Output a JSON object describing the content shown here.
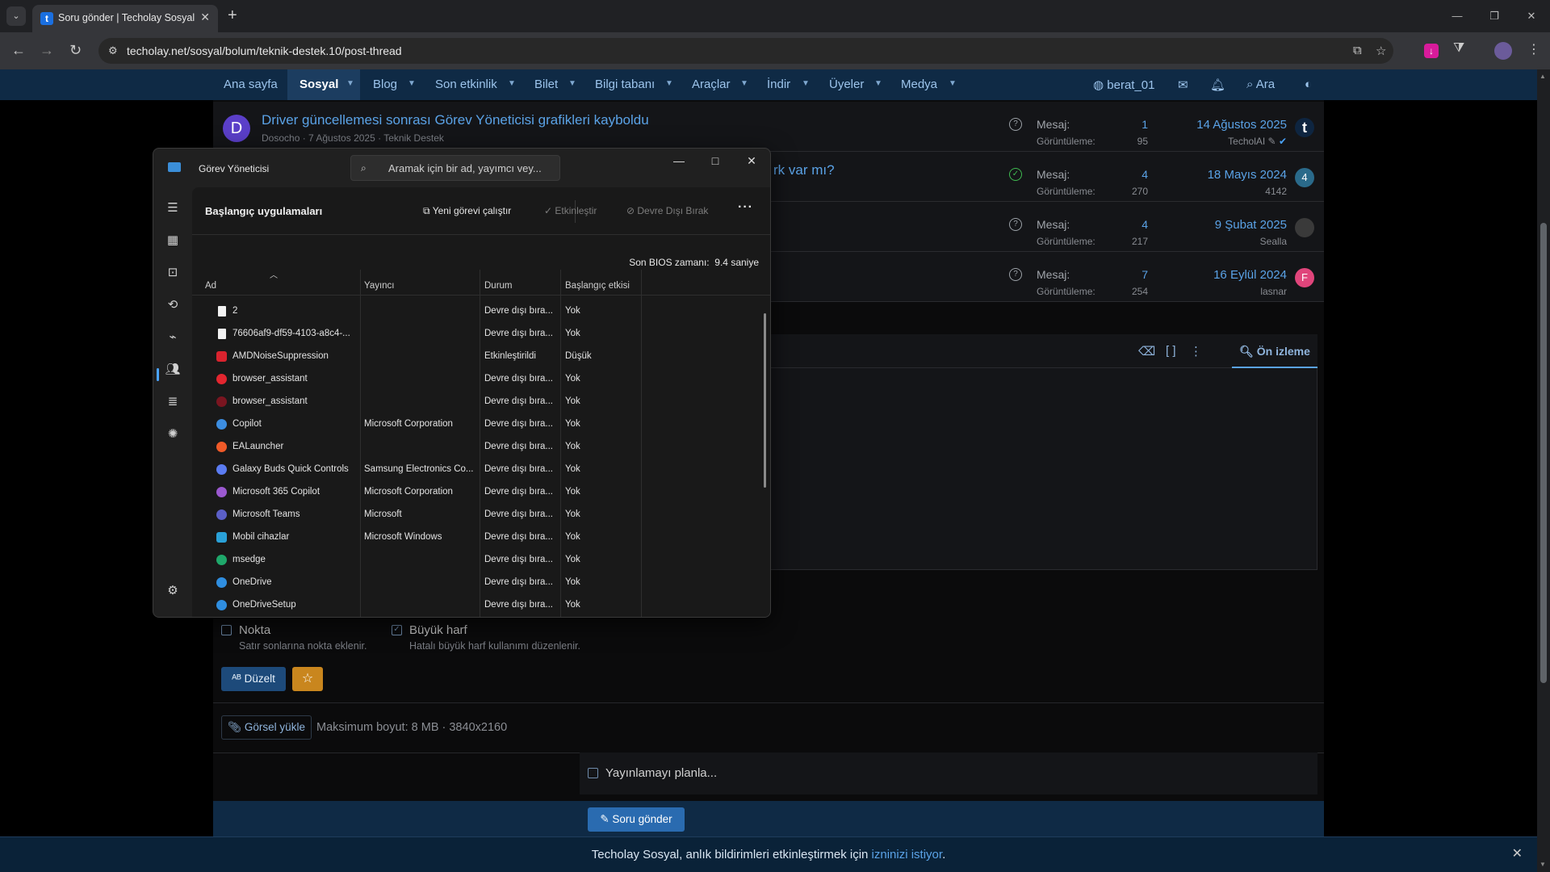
{
  "browser": {
    "tab_title": "Soru gönder | Techolay Sosyal",
    "tab_favicon_letter": "t",
    "url": "techolay.net/sosyal/bolum/teknik-destek.10/post-thread"
  },
  "site_nav": {
    "items": [
      {
        "label": "Ana sayfa"
      },
      {
        "label": "Sosyal"
      },
      {
        "label": "Blog"
      },
      {
        "label": "Son etkinlik"
      },
      {
        "label": "Bilet"
      },
      {
        "label": "Bilgi tabanı"
      },
      {
        "label": "Araçlar"
      },
      {
        "label": "İndir"
      },
      {
        "label": "Üyeler"
      },
      {
        "label": "Medya"
      }
    ],
    "username": "berat_01",
    "search_label": "Ara"
  },
  "threads": [
    {
      "avatar": "D",
      "title": "Driver güncellemesi sonrası Görev Yöneticisi grafikleri kayboldu",
      "sub": "Dosocho · 7 Ağustos 2025 · Teknik Destek",
      "msg_label": "Mesaj:",
      "view_label": "Görüntüleme:",
      "messages": "1",
      "views": "95",
      "date": "14 Ağustos 2025",
      "user": "TecholAI",
      "avatar_r": "t",
      "avatar_color": "#0e2540"
    },
    {
      "avatar": "",
      "title": "rk var mı?",
      "sub": "",
      "msg_label": "Mesaj:",
      "view_label": "Görüntüleme:",
      "messages": "4",
      "views": "270",
      "date": "18 Mayıs 2024",
      "user": "4142",
      "avatar_r": "4",
      "avatar_color": "#2a6a8a"
    },
    {
      "avatar": "",
      "title": "",
      "sub": "",
      "msg_label": "Mesaj:",
      "view_label": "Görüntüleme:",
      "messages": "4",
      "views": "217",
      "date": "9 Şubat 2025",
      "user": "Sealla",
      "avatar_r": "",
      "avatar_color": "#3a3a3a"
    },
    {
      "avatar": "",
      "title": "",
      "sub": "",
      "msg_label": "Mesaj:",
      "view_label": "Görüntüleme:",
      "messages": "7",
      "views": "254",
      "date": "16 Eylül 2024",
      "user": "lasnar",
      "avatar_r": "F",
      "avatar_color": "#e0457b"
    }
  ],
  "editor": {
    "preview_label": "Ön izleme"
  },
  "options": {
    "nokta_label": "Nokta",
    "nokta_desc": "Satır sonlarına nokta eklenir.",
    "buyuk_label": "Büyük harf",
    "buyuk_desc": "Hatalı büyük harf kullanımı düzenlenir.",
    "duzelt_label": "Düzelt"
  },
  "upload": {
    "button_label": "Görsel yükle",
    "info": "Maksimum boyut: 8 MB · 3840x2160"
  },
  "schedule_label": "Yayınlamayı planla...",
  "submit_label": "Soru gönder",
  "notification": {
    "text": "Techolay Sosyal, anlık bildirimleri etkinleştirmek için ",
    "link": "izninizi istiyor",
    "end": "."
  },
  "task_manager": {
    "title": "Görev Yöneticisi",
    "search_placeholder": "Aramak için bir ad, yayımcı vey...",
    "section_title": "Başlangıç uygulamaları",
    "run_new_task": "Yeni görevi çalıştır",
    "enable": "Etkinleştir",
    "disable": "Devre Dışı Bırak",
    "bios_label": "Son BIOS zamanı:",
    "bios_value": "9.4 saniye",
    "columns": [
      "Ad",
      "Yayıncı",
      "Durum",
      "Başlangıç etkisi"
    ],
    "rows": [
      {
        "name": "2",
        "publisher": "",
        "status": "Devre dışı bıra...",
        "impact": "Yok",
        "icon": "file-icon",
        "color": "#f2f2f2"
      },
      {
        "name": "76606af9-df59-4103-a8c4-...",
        "publisher": "",
        "status": "Devre dışı bıra...",
        "impact": "Yok",
        "icon": "file-icon",
        "color": "#f2f2f2"
      },
      {
        "name": "AMDNoiseSuppression",
        "publisher": "",
        "status": "Etkinleştirildi",
        "impact": "Düşük",
        "icon": "amd-icon",
        "color": "#d9232e"
      },
      {
        "name": "browser_assistant",
        "publisher": "",
        "status": "Devre dışı bıra...",
        "impact": "Yok",
        "icon": "opera-icon",
        "color": "#e3262f"
      },
      {
        "name": "browser_assistant",
        "publisher": "",
        "status": "Devre dışı bıra...",
        "impact": "Yok",
        "icon": "opera-gx-icon",
        "color": "#7a1520"
      },
      {
        "name": "Copilot",
        "publisher": "Microsoft Corporation",
        "status": "Devre dışı bıra...",
        "impact": "Yok",
        "icon": "copilot-icon",
        "color": "#3c8de0"
      },
      {
        "name": "EALauncher",
        "publisher": "",
        "status": "Devre dışı bıra...",
        "impact": "Yok",
        "icon": "ea-icon",
        "color": "#f05a28"
      },
      {
        "name": "Galaxy Buds Quick Controls",
        "publisher": "Samsung Electronics Co...",
        "status": "Devre dışı bıra...",
        "impact": "Yok",
        "icon": "galaxy-buds-icon",
        "color": "#5b7cf2"
      },
      {
        "name": "Microsoft 365 Copilot",
        "publisher": "Microsoft Corporation",
        "status": "Devre dışı bıra...",
        "impact": "Yok",
        "icon": "m365-icon",
        "color": "#9b59d0"
      },
      {
        "name": "Microsoft Teams",
        "publisher": "Microsoft",
        "status": "Devre dışı bıra...",
        "impact": "Yok",
        "icon": "teams-icon",
        "color": "#5b5fc7"
      },
      {
        "name": "Mobil cihazlar",
        "publisher": "Microsoft Windows",
        "status": "Devre dışı bıra...",
        "impact": "Yok",
        "icon": "phone-link-icon",
        "color": "#2aa1d8"
      },
      {
        "name": "msedge",
        "publisher": "",
        "status": "Devre dışı bıra...",
        "impact": "Yok",
        "icon": "edge-icon",
        "color": "#1fa86b"
      },
      {
        "name": "OneDrive",
        "publisher": "",
        "status": "Devre dışı bıra...",
        "impact": "Yok",
        "icon": "onedrive-icon",
        "color": "#2f8ee0"
      },
      {
        "name": "OneDriveSetup",
        "publisher": "",
        "status": "Devre dışı bıra...",
        "impact": "Yok",
        "icon": "onedrive-icon",
        "color": "#2f8ee0"
      }
    ]
  }
}
